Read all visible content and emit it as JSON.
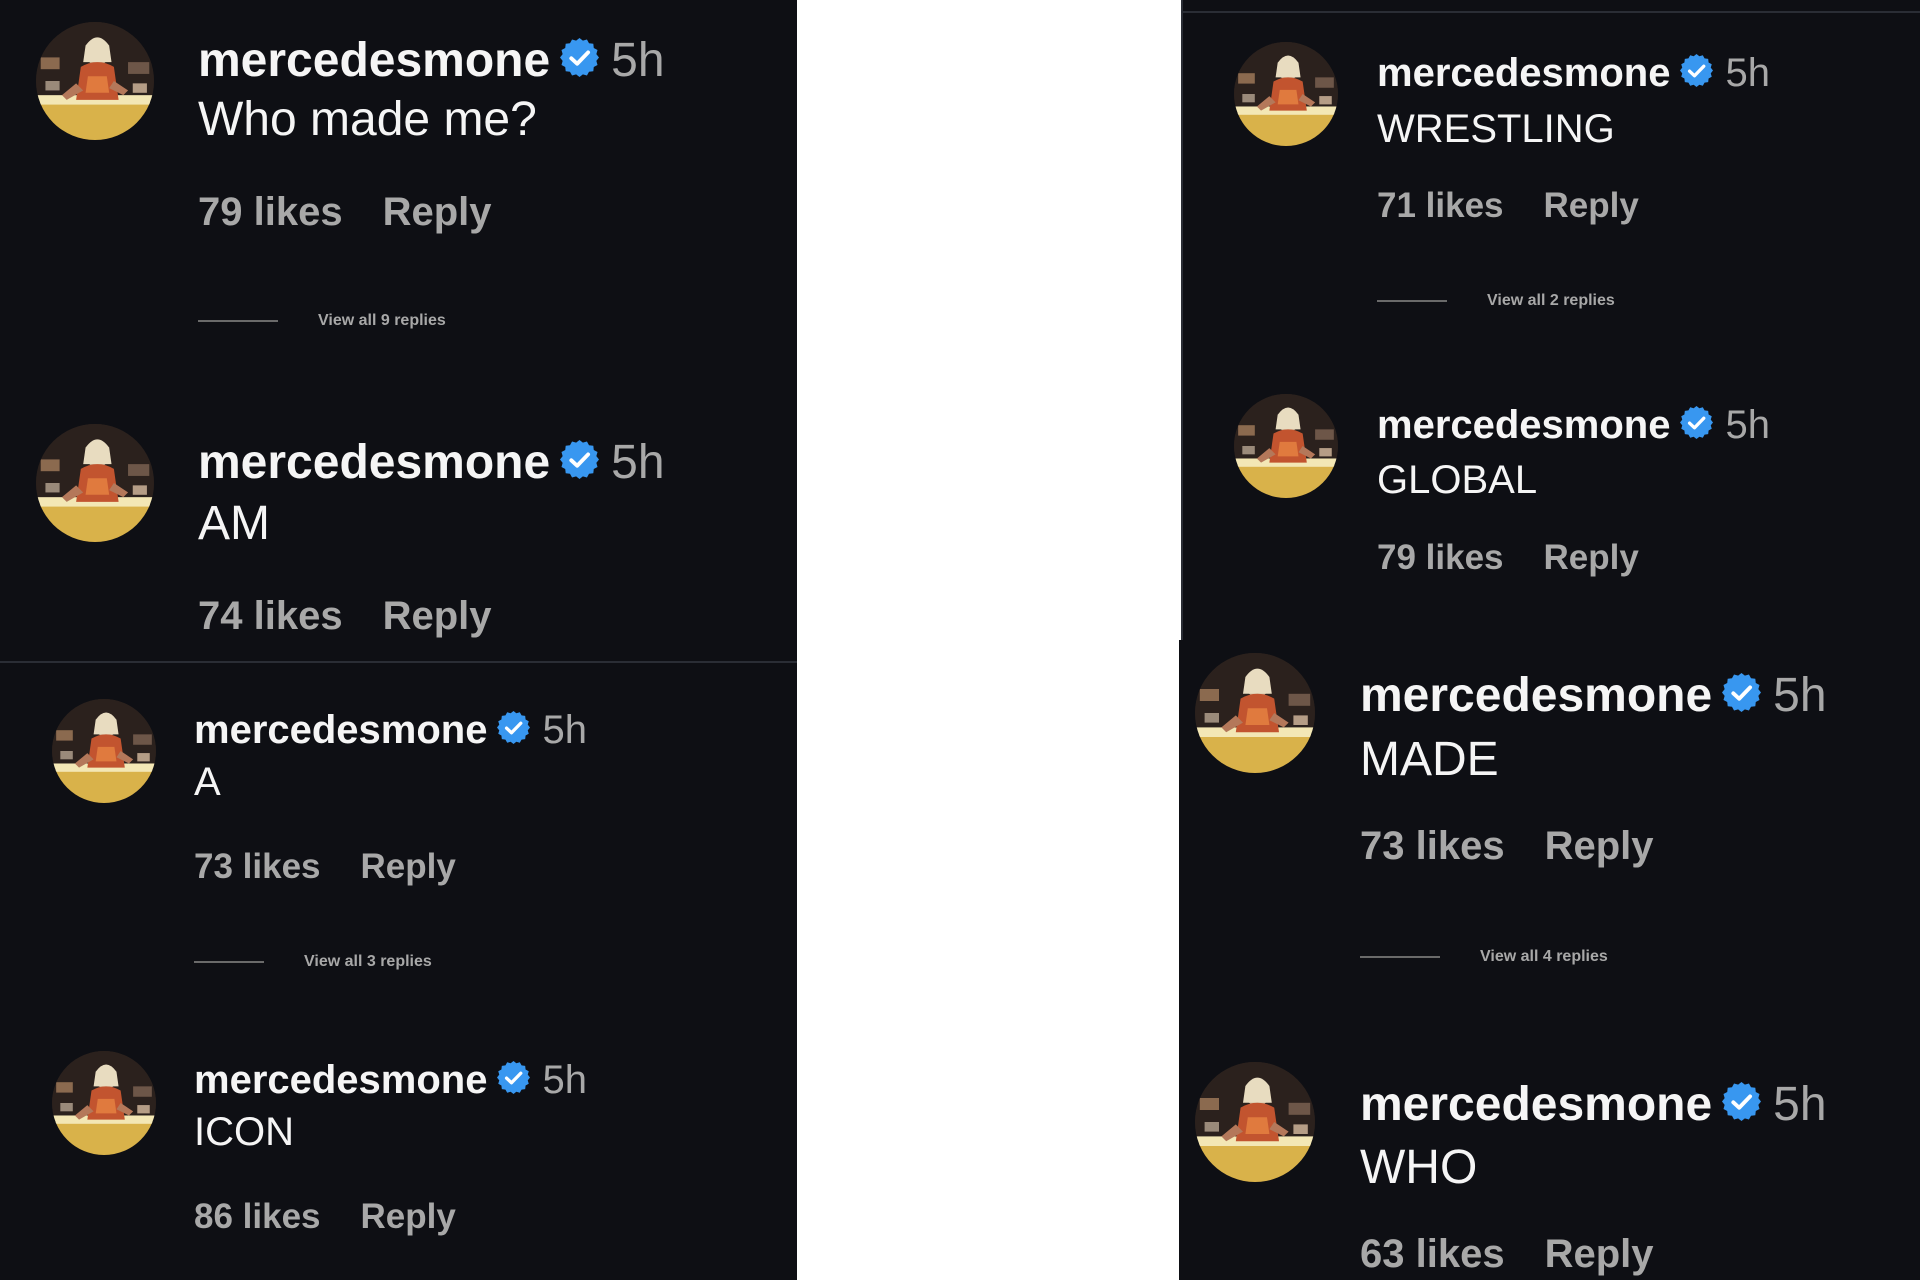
{
  "colors": {
    "background": "#0e0f14",
    "verified": "#3897f0",
    "muted_text": "#a8a8a8"
  },
  "panels": [
    {
      "comments": [
        {
          "username": "mercedesmone",
          "time": "5h",
          "text": "Who made me?",
          "likes": "79 likes",
          "reply": "Reply",
          "view_replies": "View all 9 replies"
        },
        {
          "username": "mercedesmone",
          "time": "5h",
          "text": "AM",
          "likes": "74 likes",
          "reply": "Reply"
        }
      ]
    },
    {
      "comments": [
        {
          "username": "mercedesmone",
          "time": "5h",
          "text": "A",
          "likes": "73 likes",
          "reply": "Reply",
          "view_replies": "View all 3 replies"
        },
        {
          "username": "mercedesmone",
          "time": "5h",
          "text": "ICON",
          "likes": "86 likes",
          "reply": "Reply"
        }
      ]
    },
    {
      "comments": [
        {
          "username": "mercedesmone",
          "time": "5h",
          "text": "WRESTLING",
          "likes": "71 likes",
          "reply": "Reply",
          "view_replies": "View all 2 replies"
        },
        {
          "username": "mercedesmone",
          "time": "5h",
          "text": "GLOBAL",
          "likes": "79 likes",
          "reply": "Reply"
        }
      ]
    },
    {
      "comments": [
        {
          "username": "mercedesmone",
          "time": "5h",
          "text": "MADE",
          "likes": "73 likes",
          "reply": "Reply",
          "view_replies": "View all 4 replies"
        },
        {
          "username": "mercedesmone",
          "time": "5h",
          "text": "WHO",
          "likes": "63 likes",
          "reply": "Reply"
        }
      ]
    }
  ]
}
